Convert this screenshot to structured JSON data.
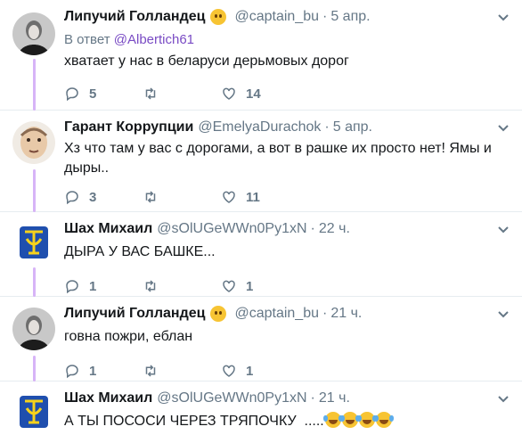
{
  "tweets": [
    {
      "name": "Липучий Голландец",
      "has_think_emoji": true,
      "handle": "@captain_bu",
      "time": "5 апр.",
      "reply_prefix": "В ответ",
      "reply_mention": "@Albertich61",
      "text": "хватает у нас в беларуси дерьмовых дорог",
      "replies": "5",
      "retweets": "",
      "likes": "14",
      "avatar": "person-dark"
    },
    {
      "name": "Гарант Коррупции",
      "handle": "@EmelyaDurachok",
      "time": "5 апр.",
      "text": "Хз что там у вас с дорогами, а вот в рашке их просто нет! Ямы и дыры..",
      "replies": "3",
      "retweets": "",
      "likes": "11",
      "avatar": "face-caricature"
    },
    {
      "name": "Шах Михаил",
      "handle": "@sOlUGeWWn0Py1xN",
      "time": "22 ч.",
      "text": "ДЫРА У ВАС БАШКЕ...",
      "replies": "1",
      "retweets": "",
      "likes": "1",
      "avatar": "blue-yellow-logo"
    },
    {
      "name": "Липучий Голландец",
      "has_think_emoji": true,
      "handle": "@captain_bu",
      "time": "21 ч.",
      "text": "говна пожри, еблан",
      "replies": "1",
      "retweets": "",
      "likes": "1",
      "avatar": "person-dark"
    },
    {
      "name": "Шах Михаил",
      "handle": "@sOlUGeWWn0Py1xN",
      "time": "21 ч.",
      "text": "А ТЫ ПОСОСИ ЧЕРЕЗ ТРЯПОЧКУ  .....",
      "emoji_suffix_count": 4,
      "avatar": "blue-yellow-logo"
    }
  ],
  "colors": {
    "thread_line": "#d7b4f7",
    "mention": "#794bc4",
    "meta": "#657786",
    "text": "#14171a"
  }
}
